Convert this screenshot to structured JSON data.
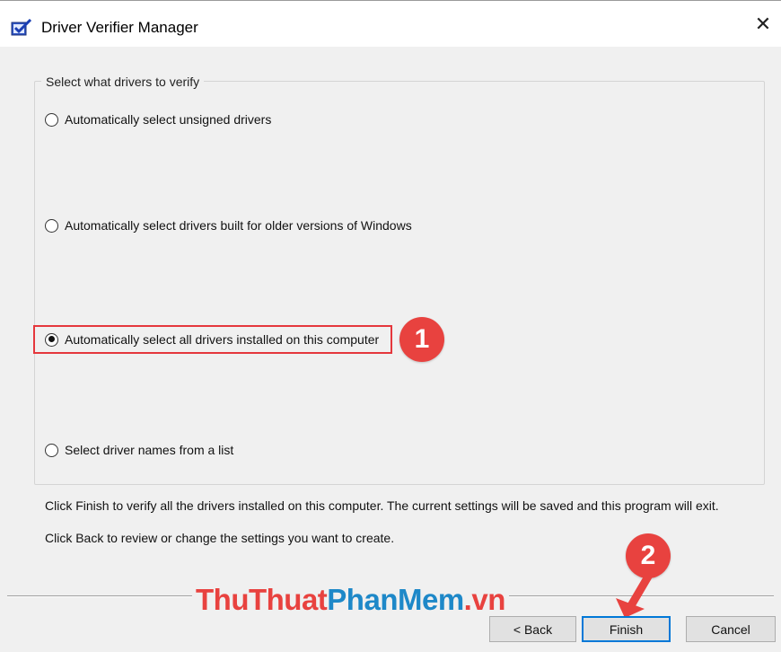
{
  "window": {
    "title": "Driver Verifier Manager",
    "icon": "driver-verifier-icon",
    "close_glyph": "✕"
  },
  "group": {
    "legend": "Select what drivers to verify",
    "options": [
      {
        "label": "Automatically select unsigned drivers",
        "checked": false
      },
      {
        "label": "Automatically select drivers built for older versions of Windows",
        "checked": false
      },
      {
        "label": "Automatically select all drivers installed on this computer",
        "checked": true
      },
      {
        "label": "Select driver names from a list",
        "checked": false
      }
    ]
  },
  "info": {
    "line1": "Click Finish to verify all the drivers installed on this computer. The current settings will be saved and this program will exit.",
    "line2": "Click Back to review or change the settings you want to create."
  },
  "buttons": {
    "back": "< Back",
    "finish": "Finish",
    "cancel": "Cancel"
  },
  "annotations": {
    "step1": "1",
    "step2": "2",
    "color": "#e8423f"
  },
  "watermark": {
    "part1": "ThuThuat",
    "part2": "PhanMem",
    "part3": ".vn"
  }
}
